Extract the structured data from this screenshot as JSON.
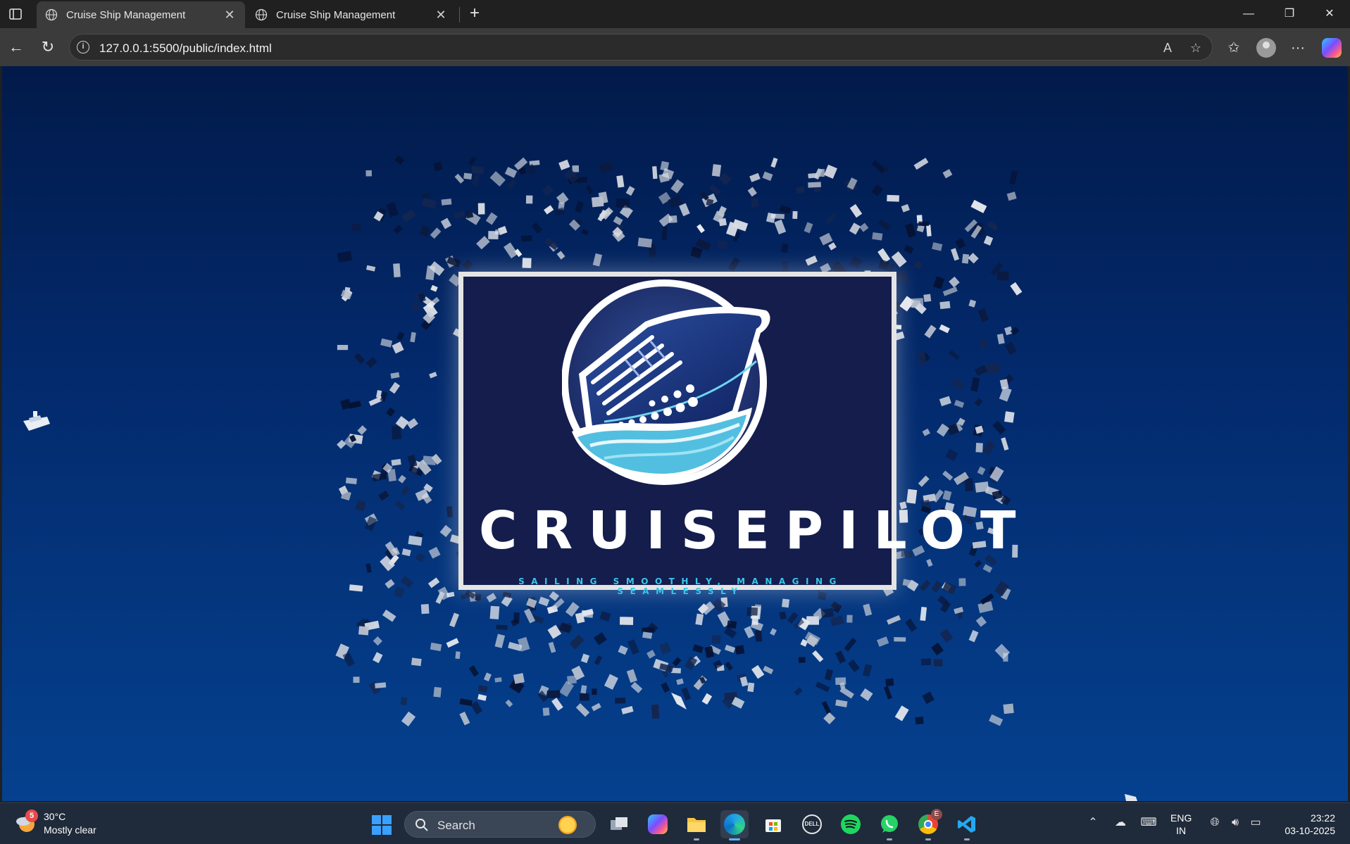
{
  "browser": {
    "tabs": [
      {
        "title": "Cruise Ship Management",
        "active": true
      },
      {
        "title": "Cruise Ship Management",
        "active": false
      }
    ],
    "url": "127.0.0.1:5500/public/index.html"
  },
  "page": {
    "brand": "CRUISEPILOT",
    "tagline": "SAILING SMOOTHLY, MANAGING SEAMLESSLY"
  },
  "taskbar": {
    "weather": {
      "badge": "5",
      "temp": "30°C",
      "desc": "Mostly clear"
    },
    "search_label": "Search",
    "chrome_badge": "E",
    "lang": {
      "line1": "ENG",
      "line2": "IN"
    },
    "clock": {
      "time": "23:22",
      "date": "03-10-2025"
    }
  },
  "colors": {
    "accent": "#38c6ea",
    "page_bg_top": "#021a4a",
    "page_bg_bottom": "#05418f",
    "logo_bg": "#141d4c"
  }
}
